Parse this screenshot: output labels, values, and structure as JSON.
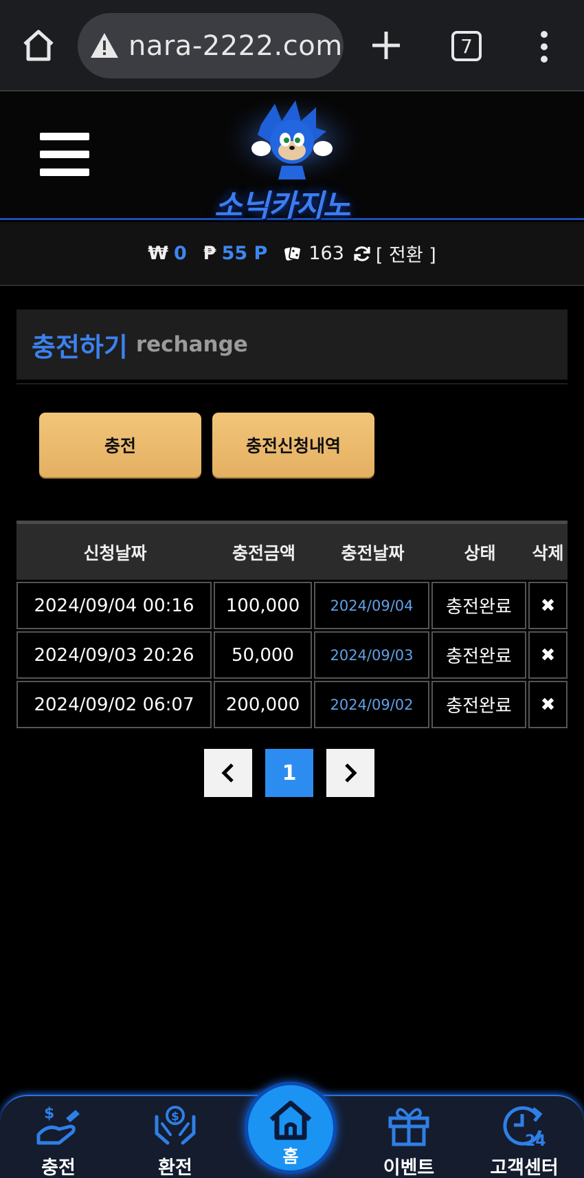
{
  "browser": {
    "url": "nara-2222.com",
    "tab_count": "7"
  },
  "site": {
    "logo_text": "소닉카지노"
  },
  "balance": {
    "money_symbol": "₩",
    "money": "0",
    "point_symbol": "₱",
    "point": "55 P",
    "chip": "163",
    "switch_label": "[ 전환 ]"
  },
  "page": {
    "title_kr": "충전하기",
    "title_en": "rechange"
  },
  "buttons": {
    "charge": "충전",
    "history": "충전신청내역"
  },
  "table": {
    "headers": [
      "신청날짜",
      "충전금액",
      "충전날짜",
      "상태",
      "삭제"
    ],
    "rows": [
      {
        "request_date": "2024/09/04 00:16",
        "amount": "100,000",
        "charge_date": "2024/09/04",
        "status": "충전완료",
        "delete": "✖"
      },
      {
        "request_date": "2024/09/03 20:26",
        "amount": "50,000",
        "charge_date": "2024/09/03",
        "status": "충전완료",
        "delete": "✖"
      },
      {
        "request_date": "2024/09/02 06:07",
        "amount": "200,000",
        "charge_date": "2024/09/02",
        "status": "충전완료",
        "delete": "✖"
      }
    ]
  },
  "pagination": {
    "prev": "‹",
    "current": "1",
    "next": "›"
  },
  "bottom_nav": {
    "charge": "충전",
    "exchange": "환전",
    "home": "홈",
    "event": "이벤트",
    "support": "고객센터"
  },
  "colors": {
    "accent": "#3b82f0",
    "button": "#e9b96b",
    "nav_bg": "#141c2e"
  }
}
